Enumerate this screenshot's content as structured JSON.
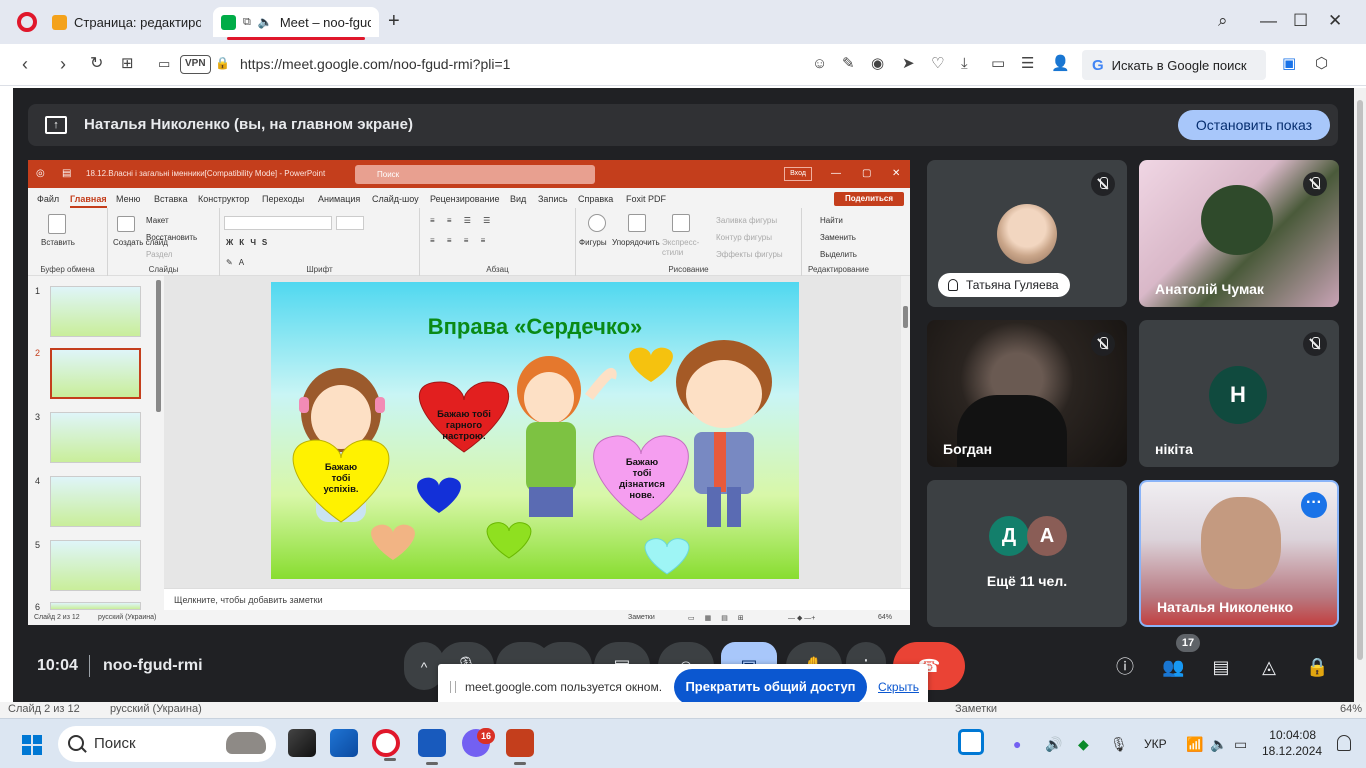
{
  "browser": {
    "tabs": [
      {
        "label": "Страница: редактирован"
      },
      {
        "label": "Meet – noo-fgud-r"
      }
    ],
    "newtab": "+",
    "url": "https://meet.google.com/noo-fgud-rmi?pli=1",
    "vpn": "VPN",
    "search_placeholder": "Искать в Google поиск"
  },
  "meet": {
    "banner_title": "Наталья Николенко (вы, на главном экране)",
    "stop_label": "Остановить показ",
    "clock": "10:04",
    "meeting_code": "noo-fgud-rmi",
    "participant_count": "17",
    "participants": [
      {
        "name": "Татьяна Гуляева"
      },
      {
        "name": "Анатолій Чумак"
      },
      {
        "name": "Богдан"
      },
      {
        "name": "нікіта",
        "initial": "Н"
      },
      {
        "name": "Ещё 11 чел.",
        "initials": [
          "Д",
          "А"
        ]
      },
      {
        "name": "Наталья Николенко"
      }
    ],
    "share_notice": {
      "message": "meet.google.com пользуется окном.",
      "stop_all": "Прекратить общий доступ",
      "hide": "Скрыть"
    },
    "colors": {
      "accent": "#a8c7fa",
      "end_call": "#ea4335",
      "background": "#202124"
    }
  },
  "ppt": {
    "title": "18.12.Власні і загальні іменники[Compatibility Mode]  -  PowerPoint",
    "search": "Поиск",
    "signin": "Вход",
    "menu": [
      "Файл",
      "Главная",
      "Меню",
      "Вставка",
      "Конструктор",
      "Переходы",
      "Анимация",
      "Слайд-шоу",
      "Рецензирование",
      "Вид",
      "Запись",
      "Справка",
      "Foxit PDF"
    ],
    "share": "Поделиться",
    "ribbon": {
      "paste": "Вставить",
      "clipboard": "Буфер обмена",
      "new_slide": "Создать слайд",
      "layout": "Макет",
      "reset": "Восстановить",
      "section": "Раздел",
      "slides": "Слайды",
      "font": "Шрифт",
      "paragraph": "Абзац",
      "shapes": "Фигуры",
      "arrange": "Упорядочить",
      "quick_styles": "Экспресс-стили",
      "fill": "Заливка фигуры",
      "outline": "Контур фигуры",
      "effects": "Эффекты фигуры",
      "drawing": "Рисование",
      "find": "Найти",
      "replace": "Заменить",
      "select": "Выделить",
      "editing": "Редактирование"
    },
    "thumb_numbers": [
      "1",
      "2",
      "3",
      "4",
      "5",
      "6"
    ],
    "slide": {
      "title": "Вправа «Сердечко»",
      "heart_texts": [
        "Бажаю тобі гарного настрою.",
        "Бажаю тобі успіхів.",
        "Бажаю тобі дізнатися нове."
      ]
    },
    "notes_placeholder": "Щелкните, чтобы добавить заметки",
    "status": {
      "slide": "Слайд 2 из 12",
      "lang": "русский (Украина)",
      "notes": "Заметки",
      "zoom": "64%"
    }
  },
  "ghost": {
    "slide": "Слайд 2 из 12",
    "lang": "русский (Украина)",
    "notes": "Заметки",
    "zoom": "64%"
  },
  "taskbar": {
    "search": "Поиск",
    "chat_badge": "16",
    "language": "УКР",
    "time": "10:04:08",
    "date": "18.12.2024"
  }
}
